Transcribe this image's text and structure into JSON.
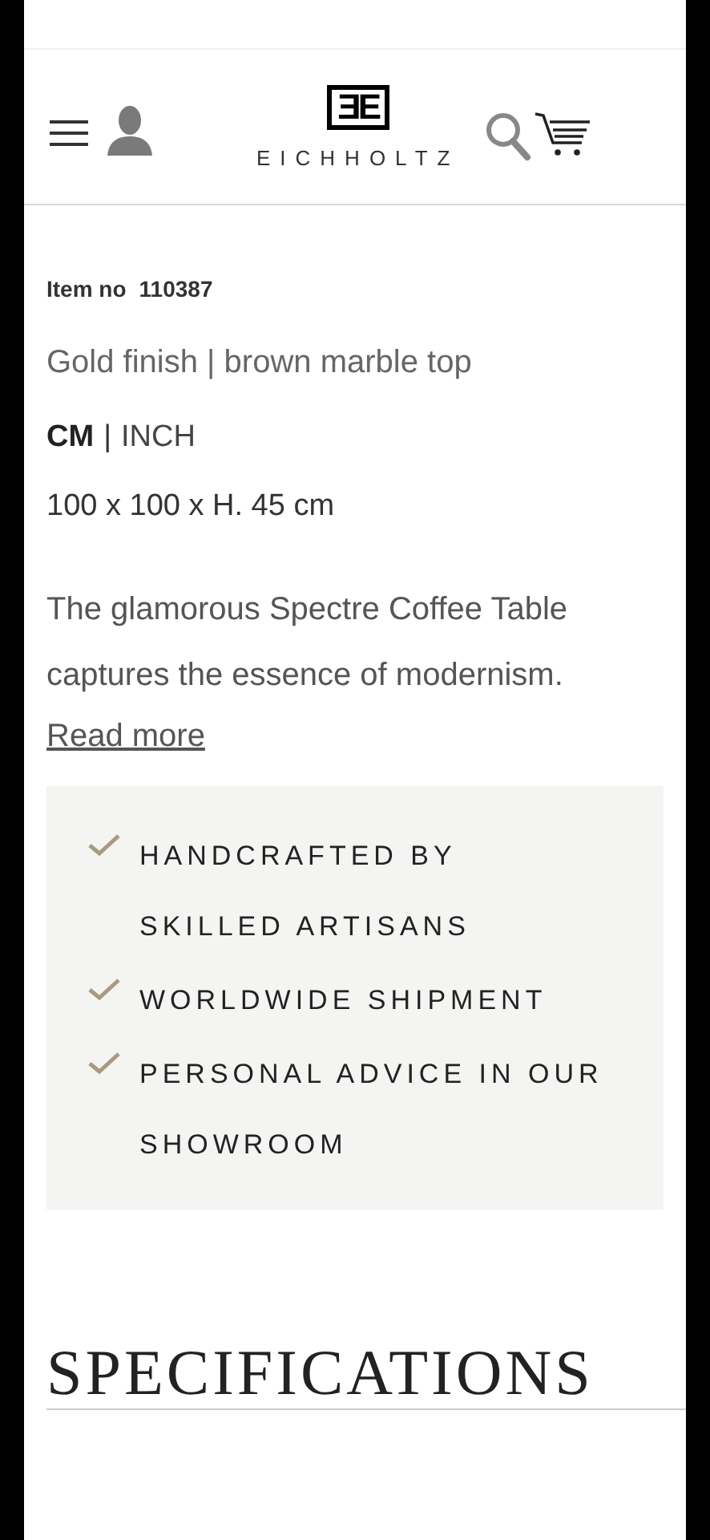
{
  "header": {
    "brand": "EICHHOLTZ",
    "logo_mark": "ƎE"
  },
  "product": {
    "item_label": "Item no",
    "item_number": "110387",
    "finish": "Gold finish | brown marble top",
    "units": [
      {
        "label": "CM",
        "selected": true
      },
      {
        "label": "INCH",
        "selected": false
      }
    ],
    "unit_separator": "|",
    "dimensions": "100 x 100 x H. 45 cm",
    "description": "The glamorous Spectre Coffee Table captures the essence of modernism.",
    "read_more": "Read more"
  },
  "benefits": [
    {
      "text": "HANDCRAFTED BY SKILLED ARTISANS"
    },
    {
      "text": "WORLDWIDE SHIPMENT"
    },
    {
      "text": "PERSONAL ADVICE IN OUR SHOWROOM"
    }
  ],
  "section_heading": "SPECIFICATIONS"
}
